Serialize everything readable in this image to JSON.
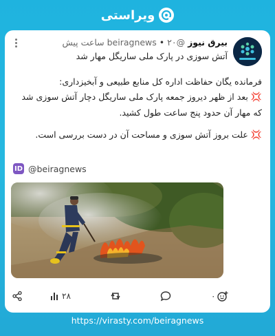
{
  "brand": {
    "name": "ویراستی",
    "accent": "#1fb3df"
  },
  "post": {
    "author_name": "بیرق نیوز",
    "author_handle": "@beiragnews",
    "time": "۲۰ ساعت پیش",
    "separator": "•",
    "summary": "آتش سوزی در پارک ملی ساریگل مهار شد",
    "paragraph_1": "فرمانده یگان حفاظت اداره کل منابع طبیعی و آبخیزداری:",
    "paragraph_1_mark": "💢",
    "paragraph_1_rest": "بعد از ظهر دیروز جمعه پارک ملی ساریگل دچار آتش سوزی شد که مهار آن حدود پنج ساعت طول کشید.",
    "paragraph_2_mark": "💢",
    "paragraph_2": "علت بروز آتش سوزی و مساحت آن در دست بررسی است.",
    "mention_badge": "ID",
    "mention": "@beiragnews"
  },
  "actions": {
    "views": "۲۸",
    "likes": "۰"
  },
  "footer": {
    "url": "https://virasty.com/beiragnews"
  }
}
